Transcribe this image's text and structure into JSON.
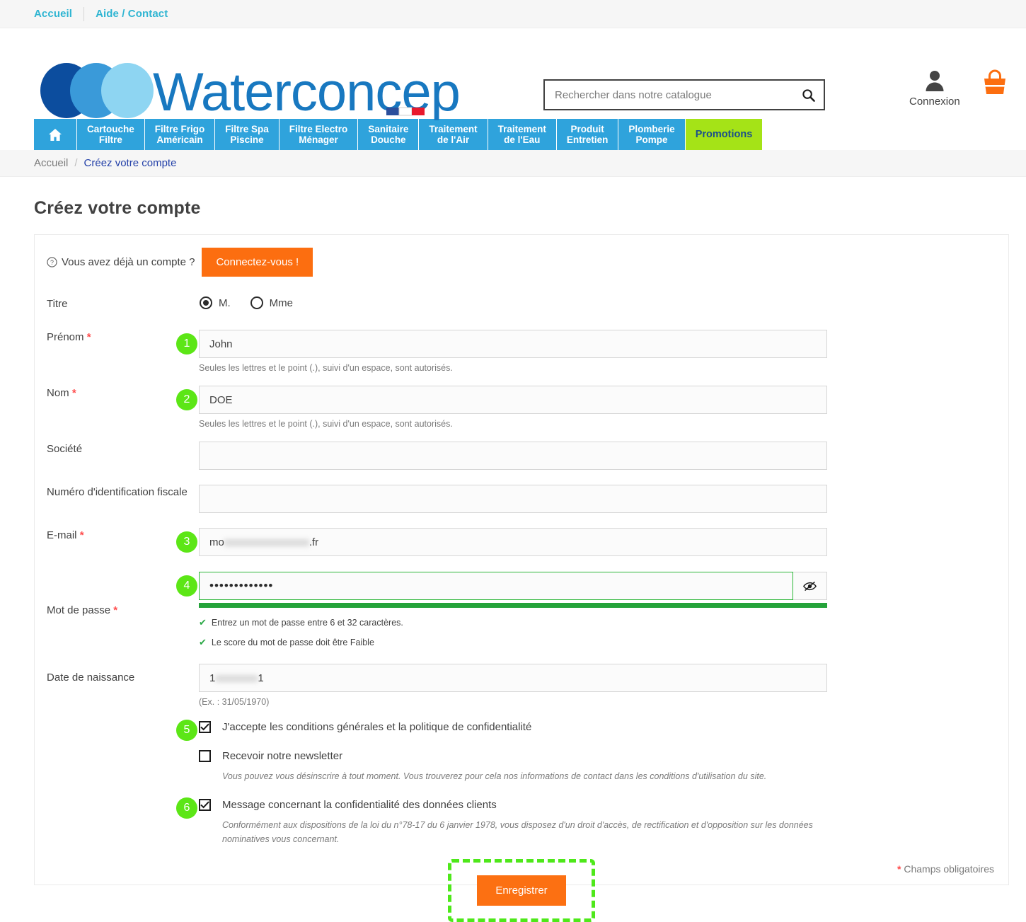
{
  "topbar": {
    "links": [
      {
        "label": "Accueil",
        "name": "topbar-link-accueil"
      },
      {
        "label": "Aide / Contact",
        "name": "topbar-link-aide-contact"
      }
    ]
  },
  "header": {
    "logo_text": "Waterconcept",
    "search": {
      "placeholder": "Rechercher dans notre catalogue",
      "value": ""
    },
    "account": {
      "login_label": "Connexion"
    }
  },
  "nav": {
    "items": [
      {
        "label": "",
        "icon": "home-icon"
      },
      {
        "label": "Cartouche\nFiltre"
      },
      {
        "label": "Filtre Frigo\nAméricain"
      },
      {
        "label": "Filtre Spa\nPiscine"
      },
      {
        "label": "Filtre Electro\nMénager"
      },
      {
        "label": "Sanitaire\nDouche"
      },
      {
        "label": "Traitement\nde l'Air"
      },
      {
        "label": "Traitement\nde l'Eau"
      },
      {
        "label": "Produit\nEntretien"
      },
      {
        "label": "Plomberie\nPompe"
      },
      {
        "label": "Promotions"
      }
    ]
  },
  "breadcrumb": {
    "home": "Accueil",
    "separator": "/",
    "current": "Créez votre compte"
  },
  "page": {
    "title": "Créez votre compte"
  },
  "form": {
    "already_account": {
      "question": "Vous avez déjà un compte ?",
      "button_label": "Connectez-vous !"
    },
    "title_field": {
      "label": "Titre",
      "options": [
        {
          "label": "M.",
          "selected": true
        },
        {
          "label": "Mme",
          "selected": false
        }
      ]
    },
    "firstname": {
      "label": "Prénom",
      "required": "*",
      "value": "John",
      "hint": "Seules les lettres et le point (.), suivi d'un espace, sont autorisés.",
      "step": "1"
    },
    "lastname": {
      "label": "Nom",
      "required": "*",
      "value": "DOE",
      "hint": "Seules les lettres et le point (.), suivi d'un espace, sont autorisés.",
      "step": "2"
    },
    "company": {
      "label": "Société",
      "value": ""
    },
    "tax_id": {
      "label": "Numéro d'identification fiscale",
      "value": ""
    },
    "email": {
      "label": "E-mail",
      "required": "*",
      "value_prefix": "mo",
      "value_redacted": "xxxxxxxxxxxxxxxx",
      "value_suffix": ".fr",
      "step": "3"
    },
    "password": {
      "label": "Mot de passe",
      "required": "*",
      "value": "•••••••••••••",
      "step": "4",
      "toggle_icon": "eye-slash-icon",
      "strength_color": "#25a33a",
      "rules": [
        "Entrez un mot de passe entre 6 et 32 caractères.",
        "Le score du mot de passe doit être Faible"
      ]
    },
    "birthdate": {
      "label": "Date de naissance",
      "value_prefix": "1",
      "value_redacted": "xxxxxxxx",
      "value_suffix": "1",
      "hint": "(Ex. : 31/05/1970)"
    },
    "terms": {
      "label": "J'accepte les conditions générales et la politique de confidentialité",
      "checked": true,
      "step": "5"
    },
    "newsletter": {
      "label": "Recevoir notre newsletter",
      "checked": false,
      "sub": "Vous pouvez vous désinscrire à tout moment. Vous trouverez pour cela nos informations de contact dans les conditions d'utilisation du site."
    },
    "privacy": {
      "label": "Message concernant la confidentialité des données clients",
      "checked": true,
      "step": "6",
      "sub": "Conformément aux dispositions de la loi du n°78-17 du 6 janvier 1978, vous disposez d'un droit d'accès, de rectification et d'opposition sur les données nominatives vous concernant."
    },
    "submit": {
      "label": "Enregistrer",
      "highlight_color": "#4ee81a"
    },
    "mandatory_note": {
      "star": "*",
      "text": "Champs obligatoires"
    }
  },
  "colors": {
    "nav_blue": "#2fa3dc",
    "promo_green": "#a5e317",
    "orange": "#fc6e10",
    "step_green": "#5ce616",
    "link_blue": "#2fb5d2"
  }
}
